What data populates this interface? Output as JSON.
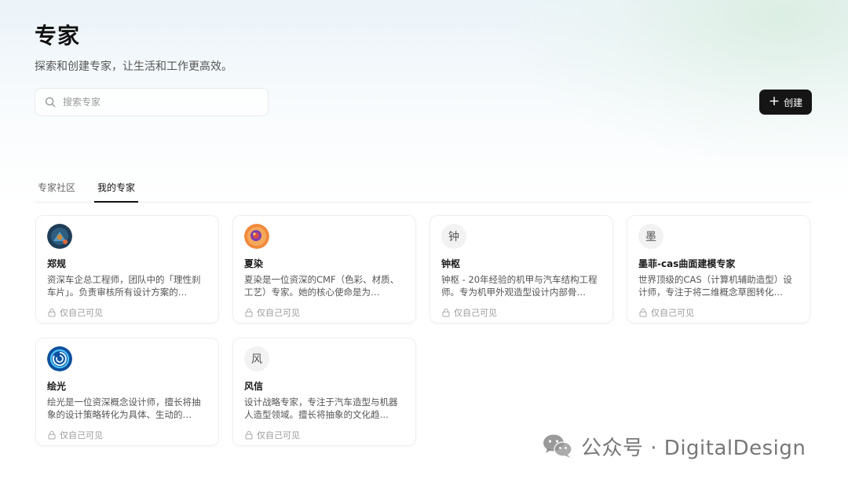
{
  "header": {
    "title": "专家",
    "subtitle": "探索和创建专家，让生活和工作更高效。"
  },
  "search": {
    "placeholder": "搜索专家",
    "value": ""
  },
  "create_button": {
    "label": "创建"
  },
  "tabs": [
    {
      "label": "专家社区",
      "active": false
    },
    {
      "label": "我的专家",
      "active": true
    }
  ],
  "experts": [
    {
      "name": "郑规",
      "avatar": "blue-gear-avatar",
      "description": "资深车企总工程师，团队中的「理性刹车片」。负责审核所有设计方案的…",
      "visibility": "仅自己可见"
    },
    {
      "name": "夏染",
      "avatar": "orange-swirl-avatar",
      "description": "夏染是一位资深的CMF（色彩、材质、工艺）专家。她的核心使命是为…",
      "visibility": "仅自己可见"
    },
    {
      "name": "钟枢",
      "avatar_letter": "钟",
      "description": "钟枢 - 20年经验的机甲与汽车结构工程师。专为机甲外观造型设计内部骨…",
      "visibility": "仅自己可见"
    },
    {
      "name": "墨菲-cas曲面建模专家",
      "avatar_letter": "墨",
      "description": "世界顶级的CAS（计算机辅助造型）设计师，专注于将二维概念草图转化…",
      "visibility": "仅自己可见"
    },
    {
      "name": "绘光",
      "avatar": "blue-spiral-avatar",
      "description": "绘光是一位资深概念设计师，擅长将抽象的设计策略转化为具体、生动的…",
      "visibility": "仅自己可见"
    },
    {
      "name": "风信",
      "avatar_letter": "风",
      "description": "设计战略专家，专注于汽车造型与机器人造型领域。擅长将抽象的文化趋…",
      "visibility": "仅自己可见"
    }
  ],
  "watermark": {
    "text": "公众号 · DigitalDesign",
    "icon": "wechat-icon"
  },
  "colors": {
    "primary_button": "#151515",
    "active_tab": "#111111",
    "muted_text": "#9a9a9a"
  }
}
